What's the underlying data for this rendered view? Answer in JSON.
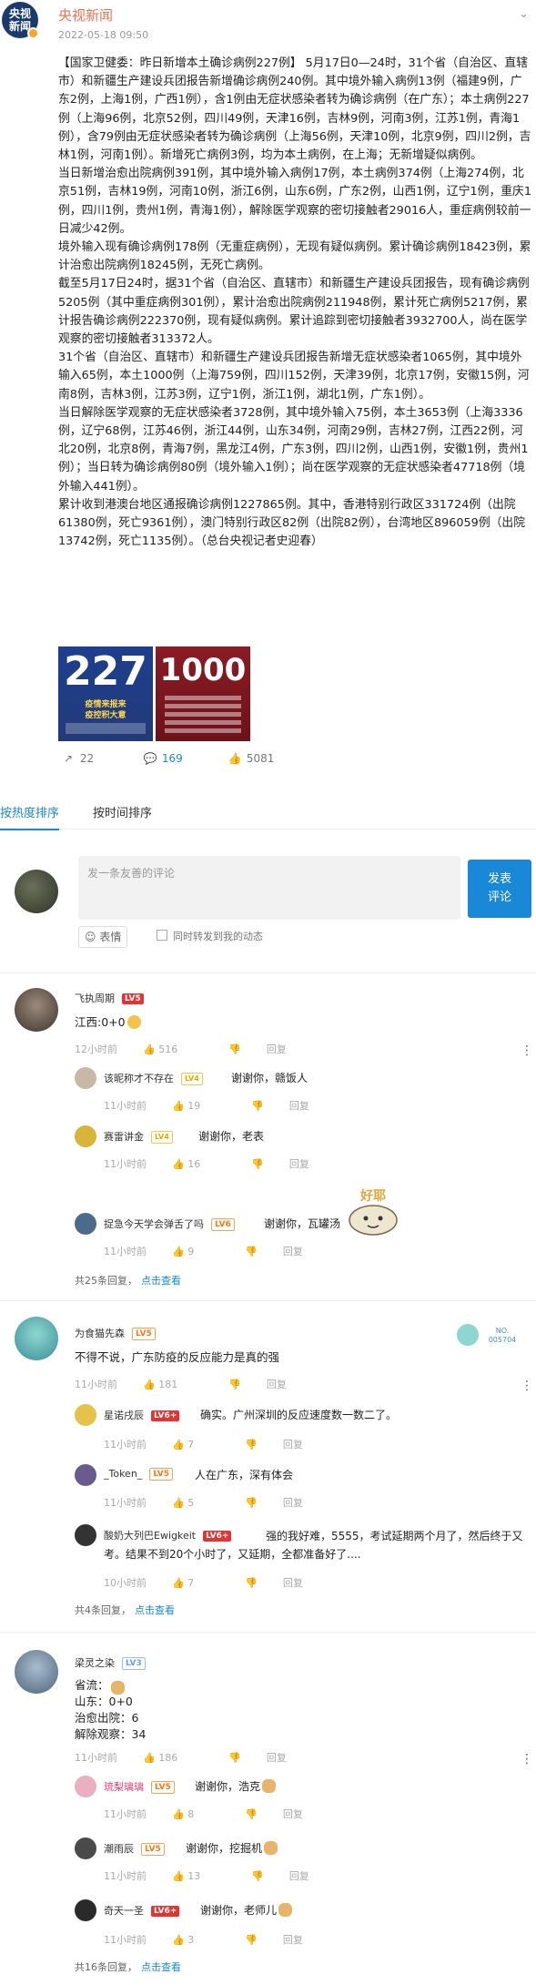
{
  "post": {
    "author": "央视新闻",
    "logo_text": "央视\n新闻",
    "time": "2022-05-18 09:50",
    "paragraphs": [
      "【国家卫健委：昨日新增本土确诊病例227例】 5月17日0—24时，31个省（自治区、直辖市）和新疆生产建设兵团报告新增确诊病例240例。其中境外输入病例13例（福建9例，广东2例，上海1例，广西1例），含1例由无症状感染者转为确诊病例（在广东）；本土病例227例（上海96例，北京52例，四川49例，天津16例，吉林9例，河南3例，江苏1例，青海1例），含79例由无症状感染者转为确诊病例（上海56例，天津10例，北京9例，四川2例，吉林1例，河南1例）。新增死亡病例3例，均为本土病例，在上海；无新增疑似病例。",
      "当日新增治愈出院病例391例，其中境外输入病例17例，本土病例374例（上海274例，北京51例，吉林19例，河南10例，浙江6例，山东6例，广东2例，山西1例，辽宁1例，重庆1例，四川1例，贵州1例，青海1例），解除医学观察的密切接触者29016人，重症病例较前一日减少42例。",
      "境外输入现有确诊病例178例（无重症病例），无现有疑似病例。累计确诊病例18423例，累计治愈出院病例18245例，无死亡病例。",
      "截至5月17日24时，据31个省（自治区、直辖市）和新疆生产建设兵团报告，现有确诊病例5205例（其中重症病例301例），累计治愈出院病例211948例，累计死亡病例5217例，累计报告确诊病例222370例，现有疑似病例。累计追踪到密切接触者3932700人，尚在医学观察的密切接触者313372人。",
      "31个省（自治区、直辖市）和新疆生产建设兵团报告新增无症状感染者1065例，其中境外输入65例，本土1000例（上海759例，四川152例，天津39例，北京17例，安徽15例，河南8例，吉林3例，江苏3例，辽宁1例，浙江1例，湖北1例，广东1例）。",
      "当日解除医学观察的无症状感染者3728例，其中境外输入75例，本土3653例（上海3336例，辽宁68例，江苏46例，浙江44例，山东34例，河南29例，吉林27例，江西22例，河北20例，北京8例，青海7例，黑龙江4例，广东3例，四川2例，山西1例，安徽1例，贵州1例）；当日转为确诊病例80例（境外输入1例）；尚在医学观察的无症状感染者47718例（境外输入441例）。",
      "累计收到港澳台地区通报确诊病例1227865例。其中，香港特别行政区331724例（出院61380例，死亡9361例），澳门特别行政区82例（出院82例），台湾地区896059例（出院13742例，死亡1135例）。（总台央视记者史迎春）"
    ],
    "images": [
      {
        "big": "227",
        "sub": "疫情来报来\n疫控积大意"
      },
      {
        "big": "1000",
        "sub": ""
      }
    ],
    "actions": {
      "share": "22",
      "comment": "169",
      "like": "5081"
    }
  },
  "tabs": [
    {
      "label": "按热度排序"
    },
    {
      "label": "按时间排序"
    }
  ],
  "compose": {
    "placeholder": "发一条友善的评论",
    "submit": "发表\n评论",
    "emoji": "表情",
    "forward": "同时转发到我的动态"
  },
  "comments": [
    {
      "name": "飞执周期",
      "level": "LV5",
      "text": "江西:0+0",
      "time": "12小时前",
      "likes": "516",
      "reply_label": "回复",
      "replies": [
        {
          "name": "该昵称才不存在",
          "level": "LV4",
          "text": "谢谢你，赣饭人",
          "time": "11小时前",
          "likes": "19"
        },
        {
          "name": "赛雷讲金",
          "level": "LV4",
          "text": "谢谢你，老表",
          "time": "11小时前",
          "likes": "16"
        },
        {
          "name": "捉急今天学会弹舌了吗",
          "level": "LV6",
          "text": "谢谢你，瓦罐汤",
          "time": "11小时前",
          "likes": "9"
        }
      ],
      "more_count": "共25条回复，",
      "more_link": "点击查看",
      "sticker_text": "好耶"
    },
    {
      "name": "为食猫先森",
      "level": "LV5",
      "text": "不得不说，广东防疫的反应能力是真的强",
      "time": "11小时前",
      "likes": "181",
      "reply_label": "回复",
      "badge": "NO.\n005704",
      "replies": [
        {
          "name": "星诺戌辰",
          "level": "LV6+",
          "text": "确实。广州深圳的反应速度数一数二了。",
          "time": "11小时前",
          "likes": "7"
        },
        {
          "name": "_Token_",
          "level": "LV5",
          "text": "人在广东，深有体会",
          "time": "11小时前",
          "likes": "5"
        },
        {
          "name": "酸奶大列巴Ewigkeit",
          "level": "LV6+",
          "text": "强的我好难，5555，考试延期两个月了，然后终于又考。结果不到20个小时了，又延期，全都准备好了....",
          "time": "10小时前",
          "likes": "7"
        }
      ],
      "more_count": "共4条回复，",
      "more_link": "点击查看"
    },
    {
      "name": "梁灵之染",
      "level": "LV3",
      "lines": [
        "省流：",
        "山东：0+0",
        "治愈出院：6",
        "解除观察：34"
      ],
      "time": "11小时前",
      "likes": "186",
      "reply_label": "回复",
      "replies": [
        {
          "name": "琉梨璃璃",
          "level": "LV5",
          "text": "谢谢你，浩克",
          "time": "11小时前",
          "likes": "8"
        },
        {
          "name": "潮雨辰",
          "level": "LV5",
          "text": "谢谢你，挖掘机",
          "time": "11小时前",
          "likes": "13"
        },
        {
          "name": "奇天一圣",
          "level": "LV6+",
          "text": "谢谢你，老师儿",
          "time": "11小时前",
          "likes": "3"
        }
      ],
      "more_count": "共16条回复，",
      "more_link": "点击查看"
    }
  ],
  "colors": {
    "accent": "#1a88d8",
    "author": "#eb7350",
    "level_red": "#e53333",
    "level_orange": "#f27a1a"
  }
}
